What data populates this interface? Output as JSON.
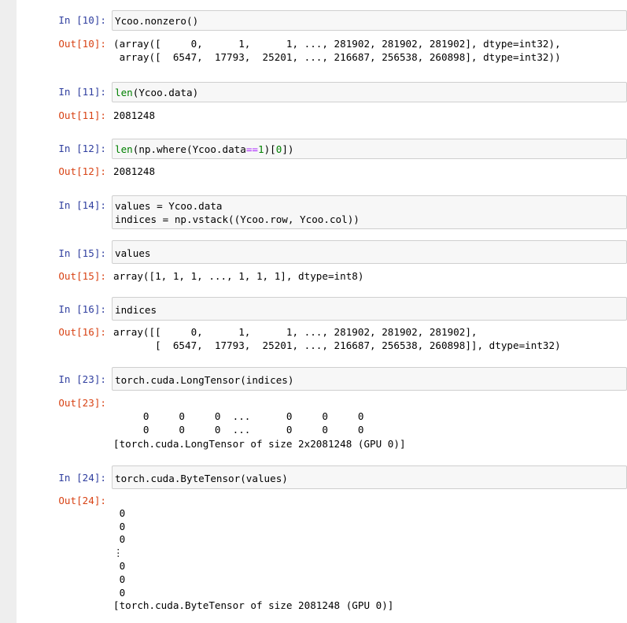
{
  "cells": [
    {
      "in_prompt": "In [10]:",
      "code": "Ycoo.nonzero()",
      "out_prompt": "Out[10]:",
      "output": "(array([     0,      1,      1, ..., 281902, 281902, 281902], dtype=int32),\n array([  6547,  17793,  25201, ..., 216687, 256538, 260898], dtype=int32))"
    },
    {
      "in_prompt": "In [11]:",
      "code_parts": [
        "len",
        "(Ycoo.data)"
      ],
      "out_prompt": "Out[11]:",
      "output": "2081248"
    },
    {
      "in_prompt": "In [12]:",
      "code_parts": [
        "len",
        "(np.where(Ycoo.data",
        "==",
        "1",
        ")[",
        "0",
        "])"
      ],
      "out_prompt": "Out[12]:",
      "output": "2081248"
    },
    {
      "in_prompt": "In [14]:",
      "code": "values = Ycoo.data\nindices = np.vstack((Ycoo.row, Ycoo.col))"
    },
    {
      "in_prompt": "In [15]:",
      "code": "values",
      "out_prompt": "Out[15]:",
      "output": "array([1, 1, 1, ..., 1, 1, 1], dtype=int8)"
    },
    {
      "in_prompt": "In [16]:",
      "code": "indices",
      "out_prompt": "Out[16]:",
      "output": "array([[     0,      1,      1, ..., 281902, 281902, 281902],\n       [  6547,  17793,  25201, ..., 216687, 256538, 260898]], dtype=int32)"
    },
    {
      "in_prompt": "In [23]:",
      "code": "torch.cuda.LongTensor(indices)",
      "out_prompt": "Out[23]:",
      "output": "\n     0     0     0  ...      0     0     0\n     0     0     0  ...      0     0     0\n[torch.cuda.LongTensor of size 2x2081248 (GPU 0)]"
    },
    {
      "in_prompt": "In [24]:",
      "code": "torch.cuda.ByteTensor(values)",
      "out_prompt": "Out[24]:",
      "output": "\n 0\n 0\n 0\n⋮\n 0\n 0\n 0\n[torch.cuda.ByteTensor of size 2081248 (GPU 0)]"
    }
  ]
}
